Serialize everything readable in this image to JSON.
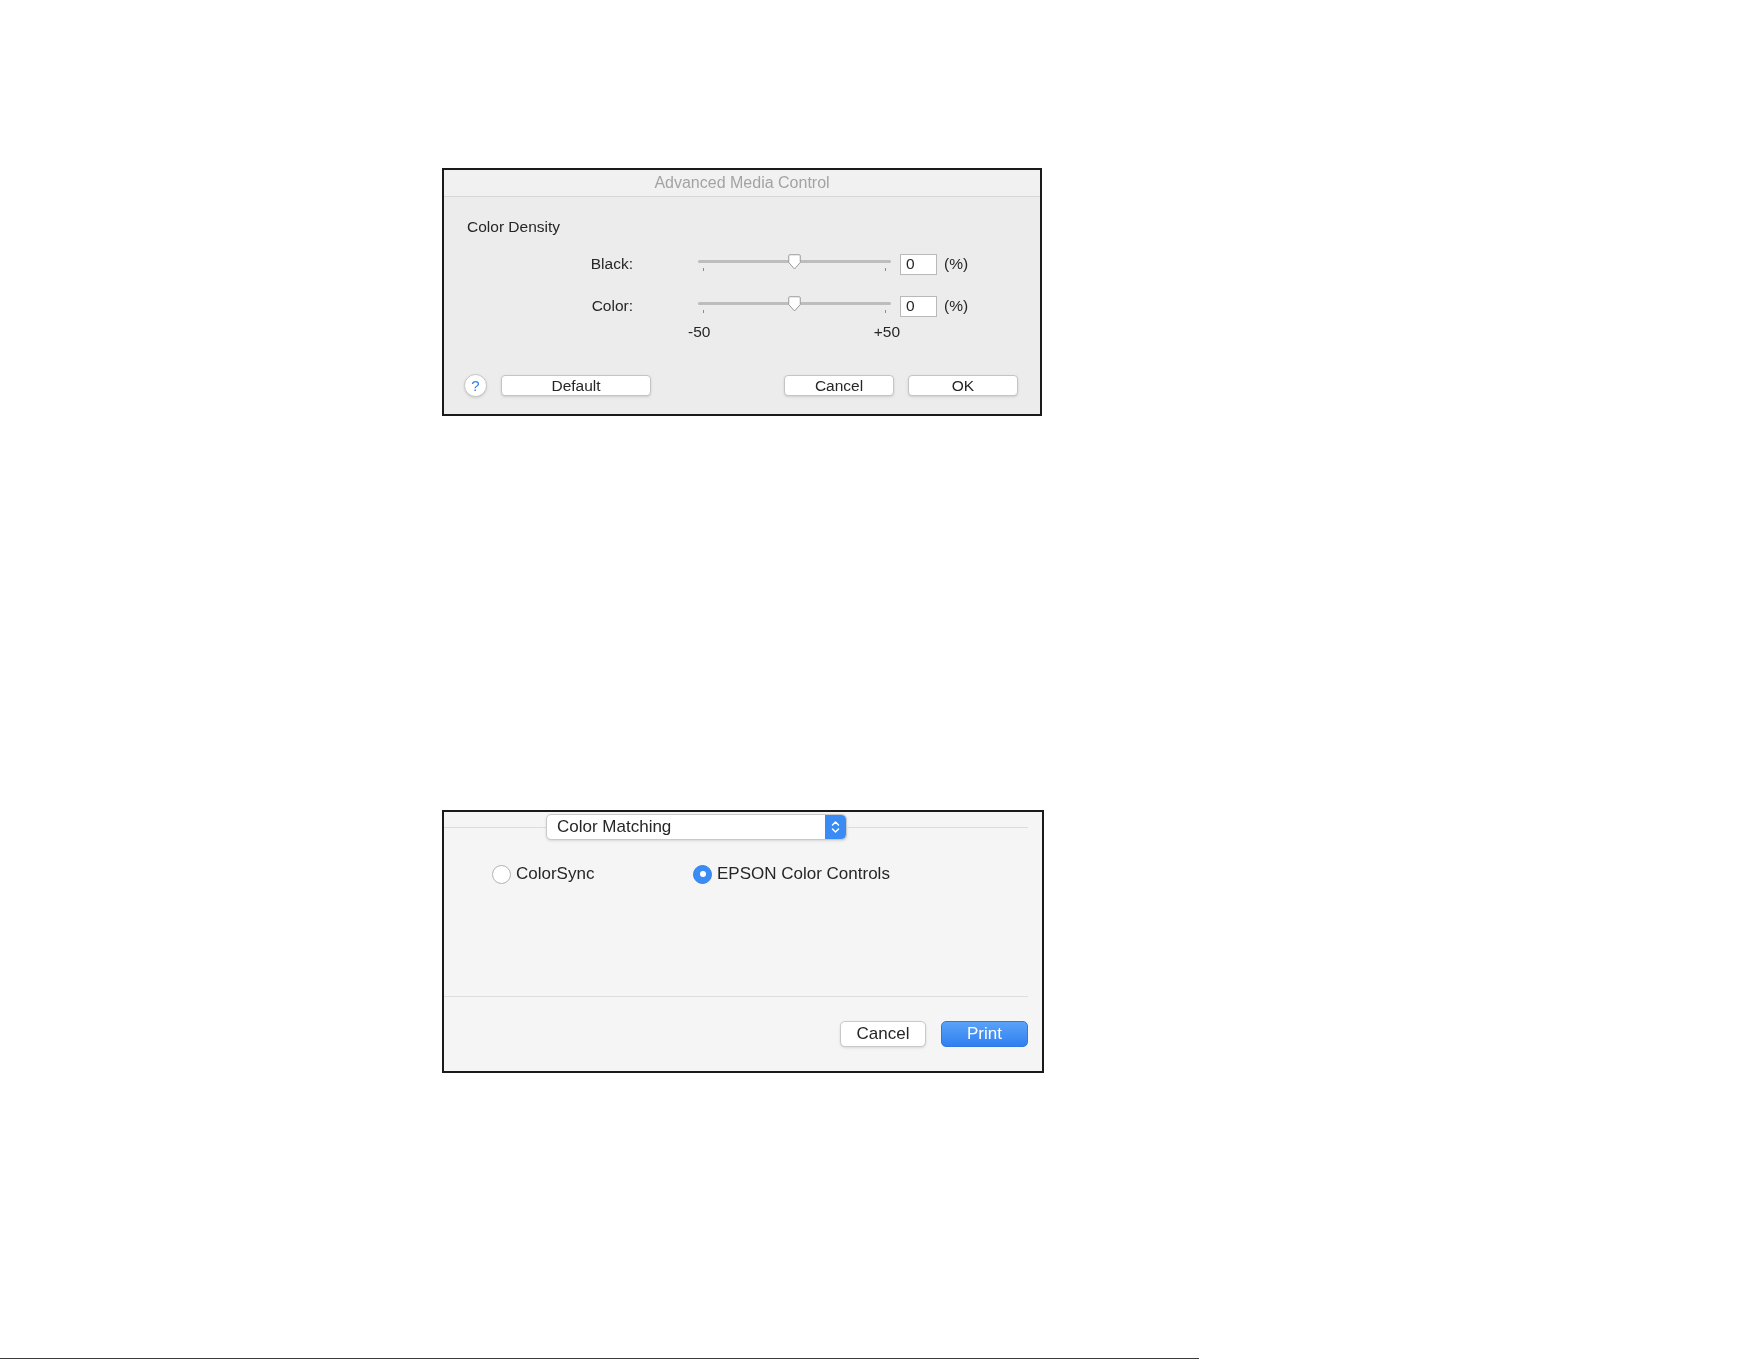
{
  "media_dialog": {
    "title": "Advanced Media Control",
    "section": "Color Density",
    "sliders": [
      {
        "label": "Black:",
        "level": 0.5,
        "value": "0",
        "unit": "(%)"
      },
      {
        "label": "Color:",
        "level": 0.5,
        "value": "0",
        "unit": "(%)"
      }
    ],
    "scale_min": "-50",
    "scale_max": "+50",
    "help": "?",
    "left_buttons": [
      "Default"
    ],
    "right_buttons": [
      "Cancel",
      "OK"
    ]
  },
  "print_dialog": {
    "popup": {
      "value": "Color Matching"
    },
    "radios": [
      {
        "label": "ColorSync",
        "selected": false
      },
      {
        "label": "EPSON Color Controls",
        "selected": true
      }
    ],
    "buttons": [
      {
        "label": "Cancel",
        "default": false
      },
      {
        "label": "Print",
        "default": true
      }
    ]
  }
}
